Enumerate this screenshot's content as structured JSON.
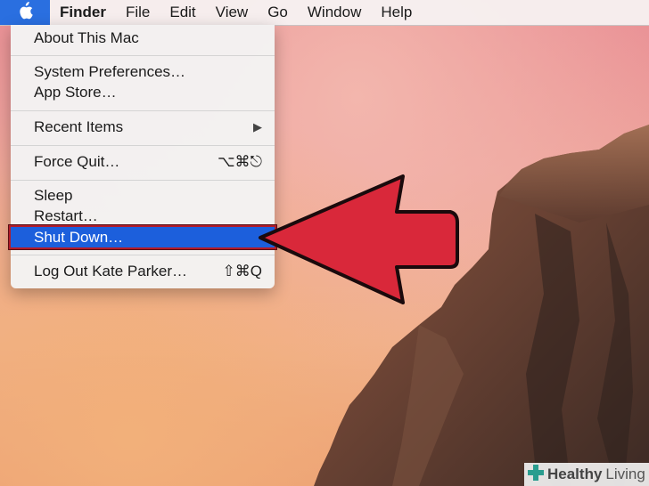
{
  "menubar": {
    "apple_icon": "apple-logo-icon",
    "items": [
      "Finder",
      "File",
      "Edit",
      "View",
      "Go",
      "Window",
      "Help"
    ]
  },
  "apple_menu": {
    "about": "About This Mac",
    "system_preferences": "System Preferences…",
    "app_store": "App Store…",
    "recent_items": "Recent Items",
    "recent_items_arrow": "▶",
    "force_quit": "Force Quit…",
    "force_quit_shortcut": "⌥⌘⎋",
    "sleep": "Sleep",
    "restart": "Restart…",
    "shut_down": "Shut Down…",
    "log_out": "Log Out Kate Parker…",
    "log_out_shortcut": "⇧⌘Q"
  },
  "watermark": {
    "brand_bold": "Healthy",
    "brand_light": "Living"
  },
  "colors": {
    "highlight": "#1c5fdc",
    "arrow": "#d9283a",
    "apple_menu_active": "#2a6fe0"
  }
}
